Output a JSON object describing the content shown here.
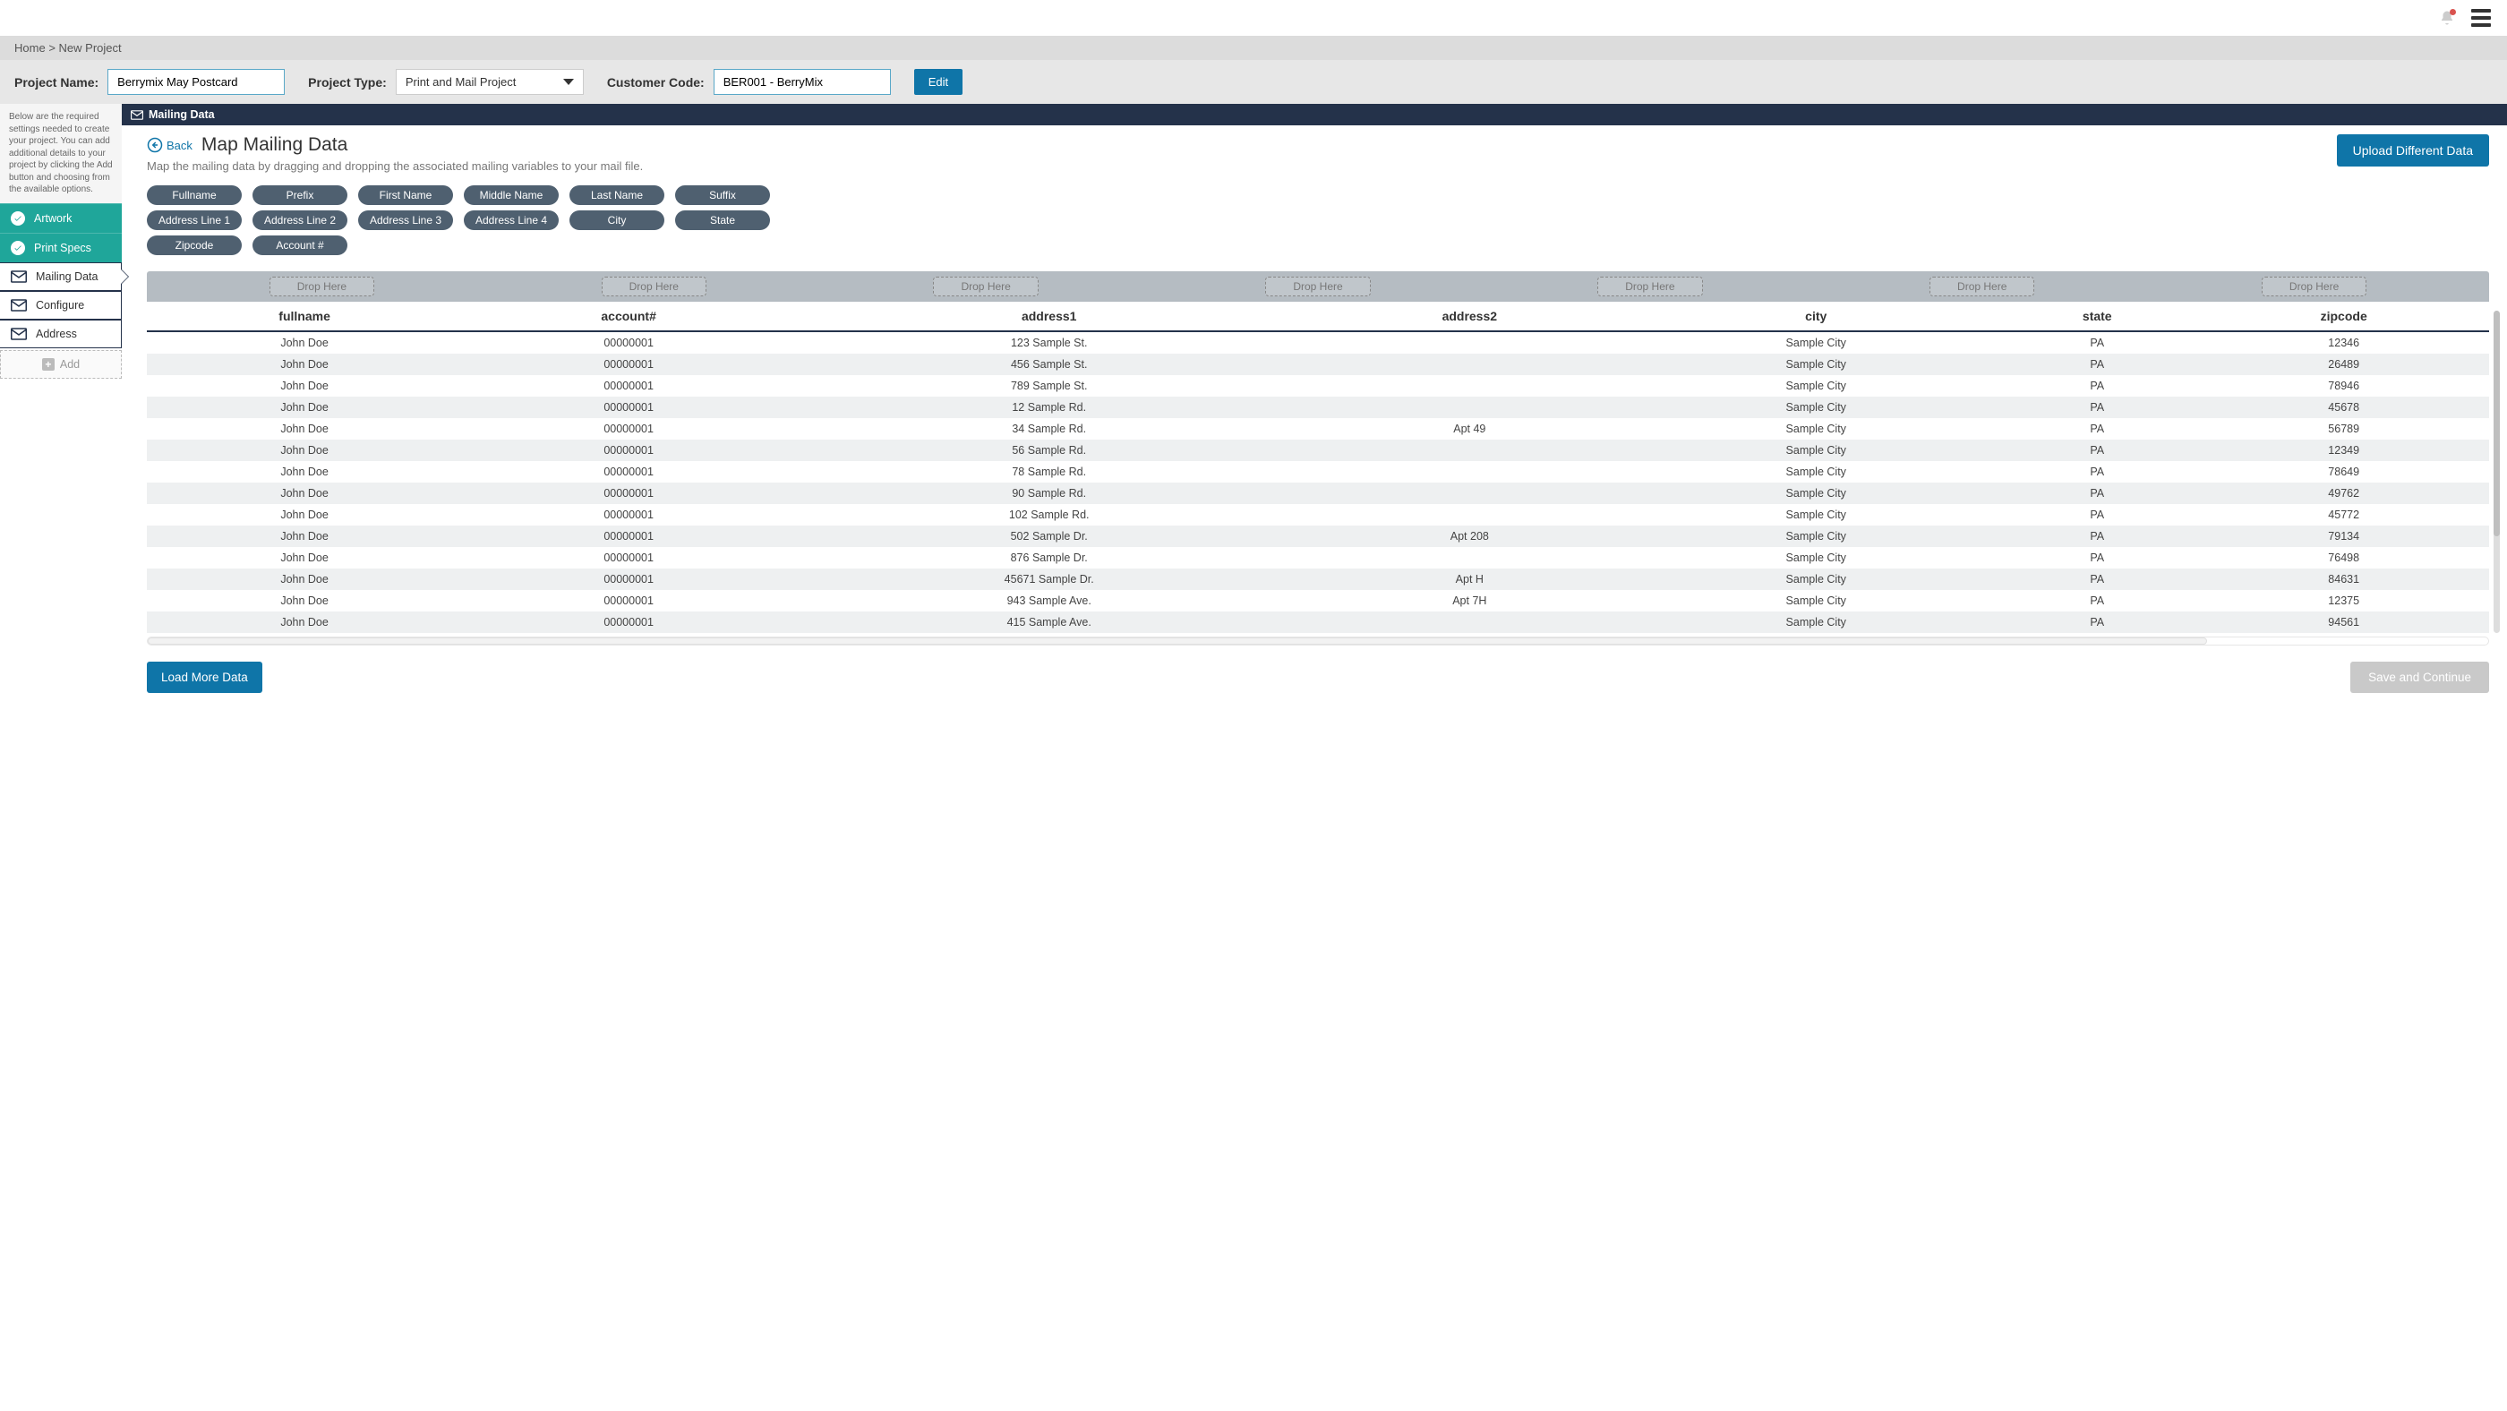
{
  "breadcrumb": {
    "home": "Home",
    "sep": ">",
    "current": "New Project"
  },
  "header": {
    "project_name_label": "Project Name:",
    "project_name_value": "Berrymix May Postcard",
    "project_type_label": "Project Type:",
    "project_type_value": "Print and Mail Project",
    "customer_code_label": "Customer Code:",
    "customer_code_value": "BER001 - BerryMix",
    "edit_label": "Edit"
  },
  "sidebar": {
    "help_text": "Below are the required settings needed to create your project. You can add additional details to your project by clicking the Add button and choosing from the available options.",
    "items": [
      {
        "label": "Artwork",
        "kind": "done"
      },
      {
        "label": "Print Specs",
        "kind": "done"
      },
      {
        "label": "Mailing Data",
        "kind": "env",
        "active": true
      },
      {
        "label": "Configure",
        "kind": "env"
      },
      {
        "label": "Address",
        "kind": "env"
      }
    ],
    "add_label": "Add"
  },
  "section_bar": "Mailing Data",
  "page": {
    "back_label": "Back",
    "title": "Map Mailing Data",
    "subtitle": "Map the mailing data by dragging and dropping the associated mailing variables to your mail file.",
    "upload_button": "Upload Different Data"
  },
  "pills": [
    "Fullname",
    "Prefix",
    "First Name",
    "Middle Name",
    "Last Name",
    "Suffix",
    "Address Line 1",
    "Address Line 2",
    "Address Line 3",
    "Address Line 4",
    "City",
    "State",
    "Zipcode",
    "Account #"
  ],
  "drop_label": "Drop Here",
  "columns": [
    "fullname",
    "account#",
    "address1",
    "address2",
    "city",
    "state",
    "zipcode"
  ],
  "rows": [
    [
      "John Doe",
      "00000001",
      "123 Sample St.",
      "",
      "Sample City",
      "PA",
      "12346"
    ],
    [
      "John Doe",
      "00000001",
      "456 Sample St.",
      "",
      "Sample City",
      "PA",
      "26489"
    ],
    [
      "John Doe",
      "00000001",
      "789 Sample St.",
      "",
      "Sample City",
      "PA",
      "78946"
    ],
    [
      "John Doe",
      "00000001",
      "12 Sample Rd.",
      "",
      "Sample City",
      "PA",
      "45678"
    ],
    [
      "John Doe",
      "00000001",
      "34 Sample Rd.",
      "Apt 49",
      "Sample City",
      "PA",
      "56789"
    ],
    [
      "John Doe",
      "00000001",
      "56 Sample Rd.",
      "",
      "Sample City",
      "PA",
      "12349"
    ],
    [
      "John Doe",
      "00000001",
      "78 Sample Rd.",
      "",
      "Sample City",
      "PA",
      "78649"
    ],
    [
      "John Doe",
      "00000001",
      "90 Sample Rd.",
      "",
      "Sample City",
      "PA",
      "49762"
    ],
    [
      "John Doe",
      "00000001",
      "102 Sample Rd.",
      "",
      "Sample City",
      "PA",
      "45772"
    ],
    [
      "John Doe",
      "00000001",
      "502 Sample Dr.",
      "Apt 208",
      "Sample City",
      "PA",
      "79134"
    ],
    [
      "John Doe",
      "00000001",
      "876 Sample Dr.",
      "",
      "Sample City",
      "PA",
      "76498"
    ],
    [
      "John Doe",
      "00000001",
      "45671 Sample Dr.",
      "Apt H",
      "Sample City",
      "PA",
      "84631"
    ],
    [
      "John Doe",
      "00000001",
      "943 Sample Ave.",
      "Apt 7H",
      "Sample City",
      "PA",
      "12375"
    ],
    [
      "John Doe",
      "00000001",
      "415 Sample Ave.",
      "",
      "Sample City",
      "PA",
      "94561"
    ]
  ],
  "footer": {
    "load_more": "Load More Data",
    "save_continue": "Save and Continue"
  }
}
